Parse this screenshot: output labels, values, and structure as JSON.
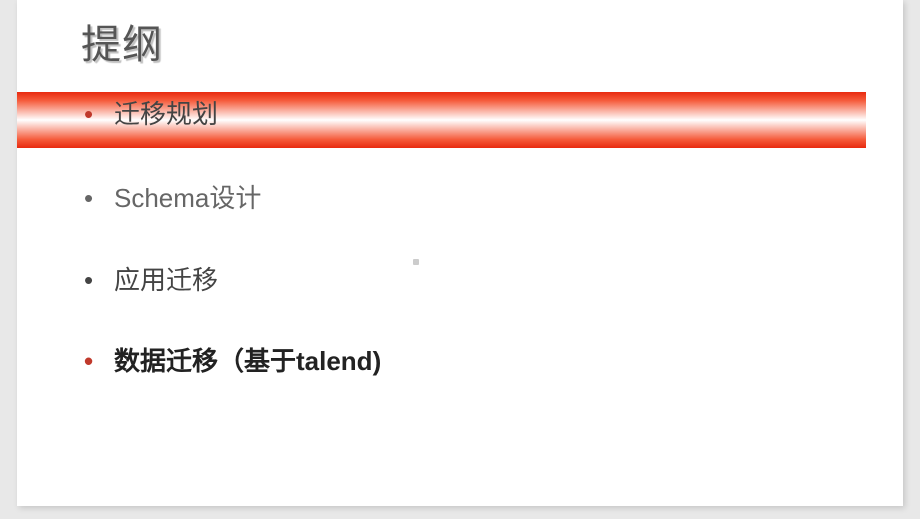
{
  "slide": {
    "title": "提纲",
    "items": [
      {
        "text": "迁移规划",
        "highlighted": true
      },
      {
        "text": "Schema设计",
        "highlighted": false
      },
      {
        "text": "应用迁移",
        "highlighted": false
      },
      {
        "text": "数据迁移（基于talend)",
        "highlighted": false
      }
    ]
  }
}
